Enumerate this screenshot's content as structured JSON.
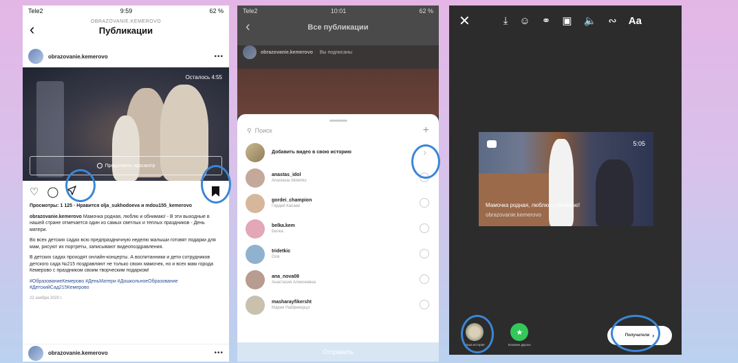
{
  "phone1": {
    "status": {
      "carrier": "Tele2",
      "time": "9:59",
      "battery": "62 %"
    },
    "header": {
      "account": "OBRAZOVANIE.KEMEROVO",
      "title": "Публикации"
    },
    "post": {
      "username": "obrazovanie.kemerovo",
      "remaining": "Осталось 4:55",
      "continue_label": "Продолжить просмотр",
      "views_line": "Просмотры: 1 125 · Нравится olja_sukhodoeva и mdou155_kemerovo",
      "caption_user": "obrazovanie.kemerovo",
      "caption_main": "Мамочка родная, люблю и обнимаю! - В эти выходные в нашей стране отмечается один из самых светлых и теплых праздников - День матери.",
      "paragraph2": "Во всех детских садах всю предпраздничную неделю малыши готовят подарки для мам, рисуют их портреты, записывают видеопоздравления.",
      "paragraph3": "В детских садах проходят онлайн-концерты. А воспитанники и дети сотрудников детского сада №215 поздравляют не только своих мамочек, но и всех мам города Кемерово с праздником своим творческим подарком!",
      "hashtags": "#ОбразованиеКемерово #ДеньМатери #ДошкольноеОбразование #ДетскийСад215Кемерово",
      "date": "22 ноября 2020 г.",
      "next_username": "obrazovanie.kemerovo"
    }
  },
  "phone2": {
    "status": {
      "carrier": "Tele2",
      "time": "10:01",
      "battery": "62 %"
    },
    "header": {
      "title": "Все публикации"
    },
    "post_username": "obrazovanie.kemerovo",
    "following": "Вы подписаны",
    "search_placeholder": "Поиск",
    "add_story": "Добавить видео в свою историю",
    "contacts": [
      {
        "name": "anastas_idol",
        "sub": "Anastasia Idolenko"
      },
      {
        "name": "gordei_champion",
        "sub": "Гордей Капаев"
      },
      {
        "name": "belka.kem",
        "sub": "Белка"
      },
      {
        "name": "tridetkic",
        "sub": "Оля"
      },
      {
        "name": "ana_nova08",
        "sub": "Анастасия Алексеевна"
      },
      {
        "name": "masharayfikersht",
        "sub": "Мария Райфикерщт"
      }
    ],
    "send_label": "Отправить"
  },
  "phone3": {
    "story": {
      "time": "5:05",
      "caption": "Мамочка родная, люблю и обнимаю!",
      "username": "obrazovanie.kemerovo"
    },
    "your_story_label": "Ваша история",
    "close_friends_label": "Близкие друзья",
    "recipients_label": "Получатели"
  },
  "colors": {
    "highlight_ring": "#3b86d6",
    "close_friends": "#34c759"
  }
}
